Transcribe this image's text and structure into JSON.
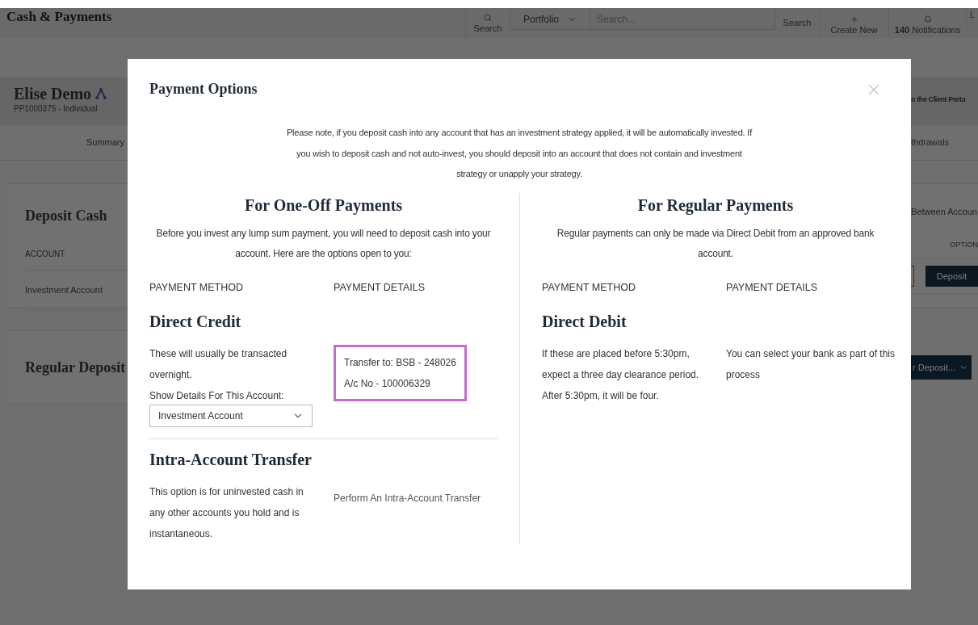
{
  "app": {
    "title": "Cash & Payments",
    "search_label": "Search",
    "portfolio_select": "Portfolio",
    "search_field": {
      "placeholder": "Search..."
    },
    "full_search": "Search",
    "create_new": "Create New",
    "notifications": {
      "count": "140",
      "label": "Notifications"
    },
    "cut_item": "L"
  },
  "client": {
    "name": "Elise Demo",
    "id": "PP1000375 - Individual",
    "portal_link": "o the Client Porta"
  },
  "nav": {
    "left_tab": "Summary",
    "right_tab": "thdrawals"
  },
  "deposit_cash": {
    "title": "Deposit Cash",
    "transfer_link": "Between Accoun",
    "columns": [
      "ACCOUNT",
      "OPTION"
    ],
    "row": {
      "account": "Investment Account",
      "button": "Deposit"
    }
  },
  "regular_deposits": {
    "title": "Regular Deposit",
    "button": "r Deposit..."
  },
  "modal": {
    "title": "Payment Options",
    "notice": "Please note, if you deposit cash into any account that has an investment strategy applied, it will be automatically invested. If you wish to deposit cash and not auto-invest, you should deposit into an account that does not contain and investment strategy or unapply your strategy.",
    "sections": [
      {
        "heading": "For One-Off Payments",
        "intro": "Before you invest any lump sum payment, you will need to deposit cash into your account. Here are the options open to you:",
        "headers": [
          "PAYMENT METHOD",
          "PAYMENT DETAILS"
        ],
        "methods": [
          {
            "name": "Direct Credit",
            "description": "These will usually be transacted overnight.",
            "details": [
              "Transfer to: BSB - 248026",
              "A/c No - 100006329"
            ],
            "highlighted": true,
            "select": {
              "label": "Show Details For This Account:",
              "value": "Investment Account"
            }
          },
          {
            "name": "Intra-Account Transfer",
            "description": "This option is for uninvested cash in any other accounts you hold and is instantaneous.",
            "link": "Perform An Intra-Account Transfer"
          }
        ]
      },
      {
        "heading": "For Regular Payments",
        "intro": "Regular payments can only be made via Direct Debit from an approved bank account.",
        "headers": [
          "PAYMENT METHOD",
          "PAYMENT DETAILS"
        ],
        "methods": [
          {
            "name": "Direct Debit",
            "description": "If these are placed before 5:30pm, expect a three day clearance period. After 5:30pm, it will be four.",
            "details": [
              "You can select your bank as part of this process"
            ],
            "highlighted": false
          }
        ]
      }
    ]
  }
}
